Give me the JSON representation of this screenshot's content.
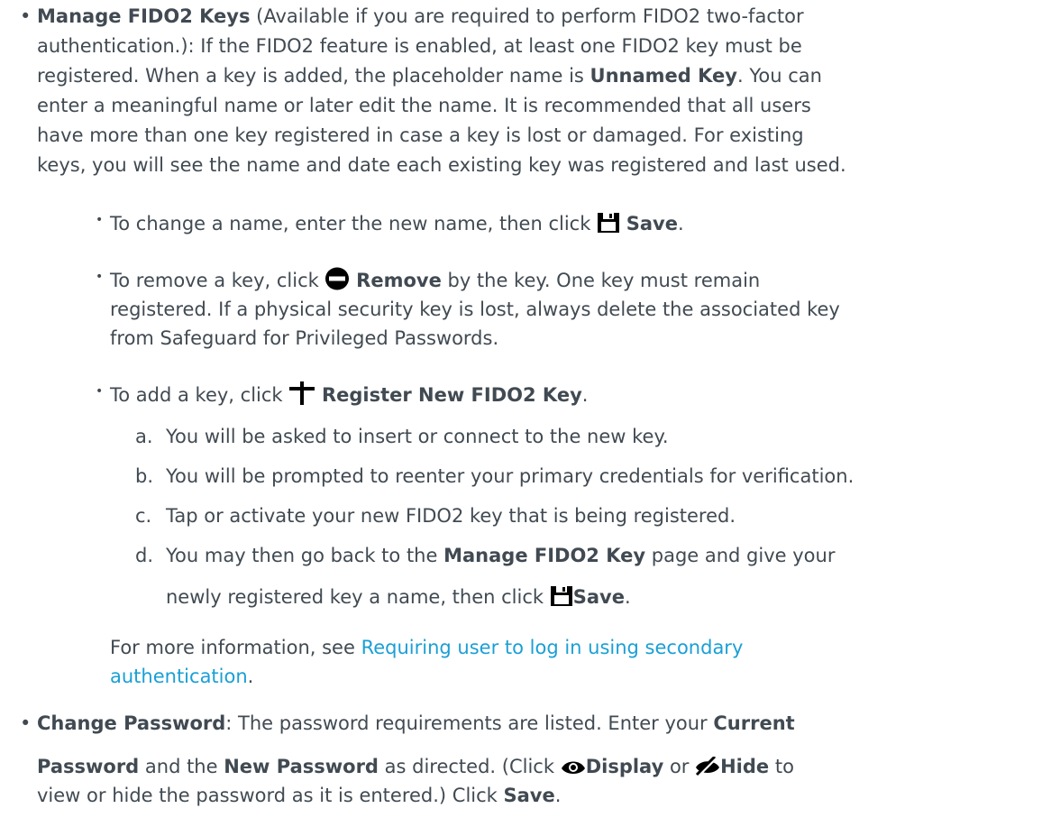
{
  "fido": {
    "title": "Manage FIDO2 Keys",
    "p_line1": " (Available if you are required to perform FIDO2 two-factor",
    "p_line2": "authentication.): If the FIDO2 feature is enabled, at least one FIDO2 key must be",
    "p_line3a": "registered. When a key is added, the placeholder name is ",
    "p_line3b": "Unnamed Key",
    "p_line3c": ". You can",
    "p_line4": "enter a meaningful name or later edit the name. It is recommended that all users",
    "p_line5": "have more than one key registered in case a key is lost or damaged. For existing",
    "p_line6": "keys, you will see the name and date each existing key was registered and last used.",
    "change_name_a": "To change a name, enter the new name, then click ",
    "change_name_b": "Save",
    "remove_a": "To remove a key, click ",
    "remove_b": "Remove",
    "remove_c": " by the key. One key must remain",
    "remove_line2": "registered. If a physical security key is lost, always delete the associated key",
    "remove_line3": "from Safeguard for Privileged Passwords.",
    "add_a": "To add a key, click ",
    "add_b": "Register New FIDO2 Key",
    "add_c": ".",
    "steps": {
      "a_marker": "a.",
      "a_text": "You will be asked to insert or connect to the new key.",
      "b_marker": "b.",
      "b_text": "You will be prompted to reenter your primary credentials for verification.",
      "c_marker": "c.",
      "c_text": "Tap or activate your new FIDO2 key that is being registered.",
      "d_marker": "d.",
      "d_text1a": "You may then go back to the ",
      "d_text1b": "Manage FIDO2 Key",
      "d_text1c": " page and give your",
      "d_text2a": "newly registered key a name, then click ",
      "d_text2b": "Save",
      "d_text2c": "."
    },
    "more_info_a": "For more information, see ",
    "more_info_link1": "Requiring user to log in using secondary",
    "more_info_link2": "authentication",
    "more_info_end": "."
  },
  "password": {
    "title": "Change Password",
    "line1a": ": The password requirements are listed. Enter your ",
    "line1b": "Current",
    "line2a": "Password",
    "line2b": " and the ",
    "line2c": "New Password",
    "line2d": " as directed. (Click ",
    "display_label": "Display",
    "or": " or ",
    "hide_label": "Hide",
    "line2e": " to",
    "line3a": "view or hide the password as it is entered.) Click ",
    "line3b": "Save",
    "line3c": "."
  },
  "icons": {
    "save": "floppy-save-icon",
    "remove": "minus-circle-icon",
    "add": "plus-icon",
    "display": "eye-icon",
    "hide": "eye-slash-icon"
  },
  "colors": {
    "text": "#414a52",
    "link": "#1a9fd6"
  }
}
